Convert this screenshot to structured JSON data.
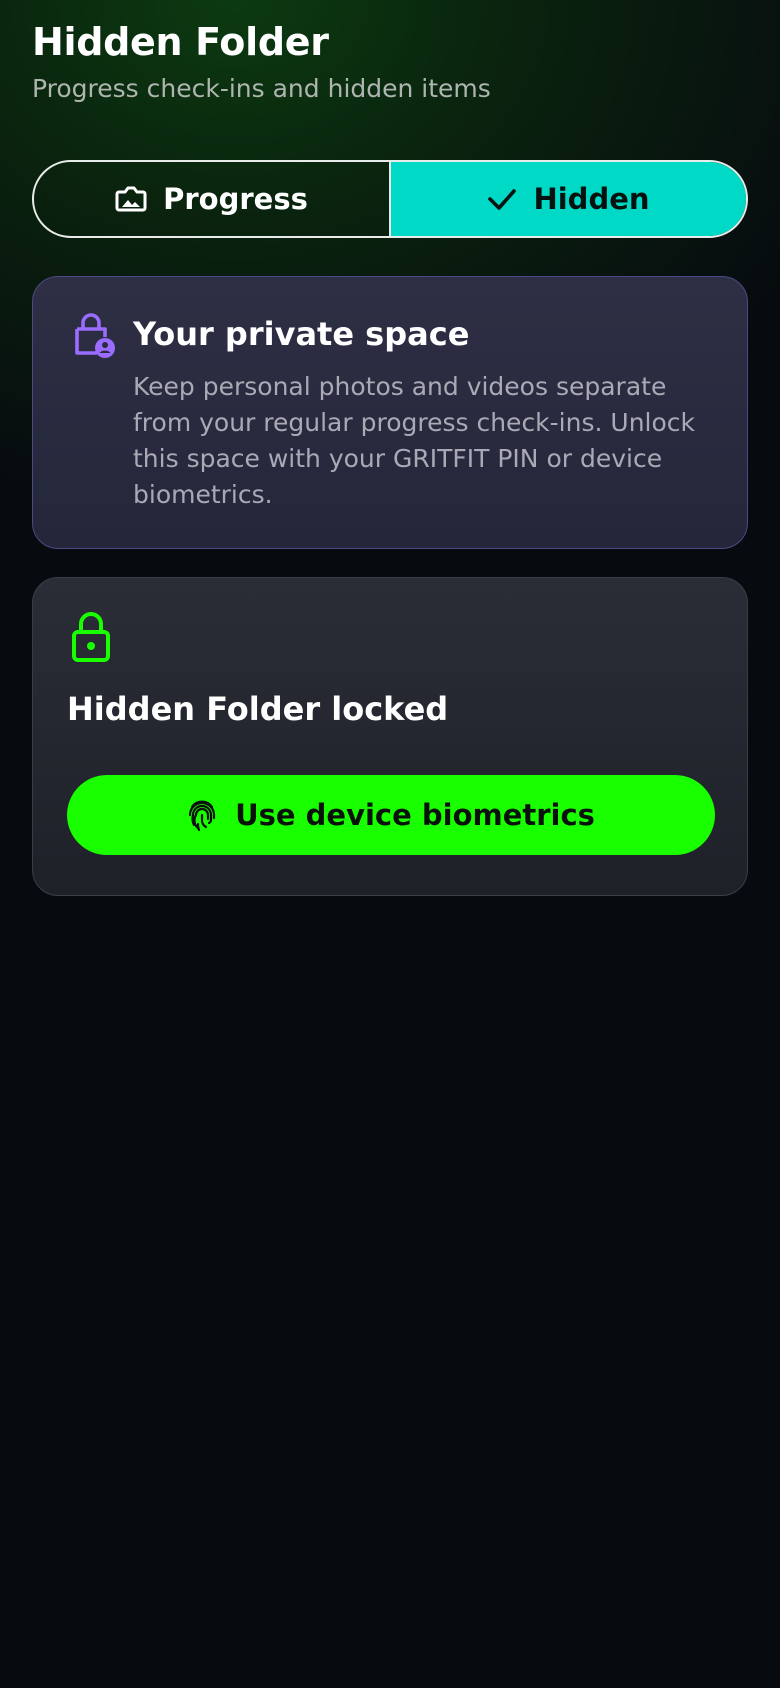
{
  "header": {
    "title": "Hidden Folder",
    "subtitle": "Progress check-ins and hidden items"
  },
  "tabs": [
    {
      "label": "Progress",
      "icon": "photo-icon",
      "selected": false
    },
    {
      "label": "Hidden",
      "icon": "check-icon",
      "selected": true
    }
  ],
  "info_card": {
    "icon": "lock-person-icon",
    "title": "Your private space",
    "text": "Keep personal photos and videos separate from your regular progress check-ins. Unlock this space with your GRITFIT PIN or device biometrics."
  },
  "locked_card": {
    "icon": "padlock-icon",
    "title": "Hidden Folder locked",
    "button_label": "Use device biometrics",
    "button_icon": "fingerprint-icon"
  },
  "colors": {
    "accent_green": "#1aff00",
    "accent_teal": "#00d9c5",
    "accent_purple": "#9a6cff",
    "background": "#070a0f"
  }
}
